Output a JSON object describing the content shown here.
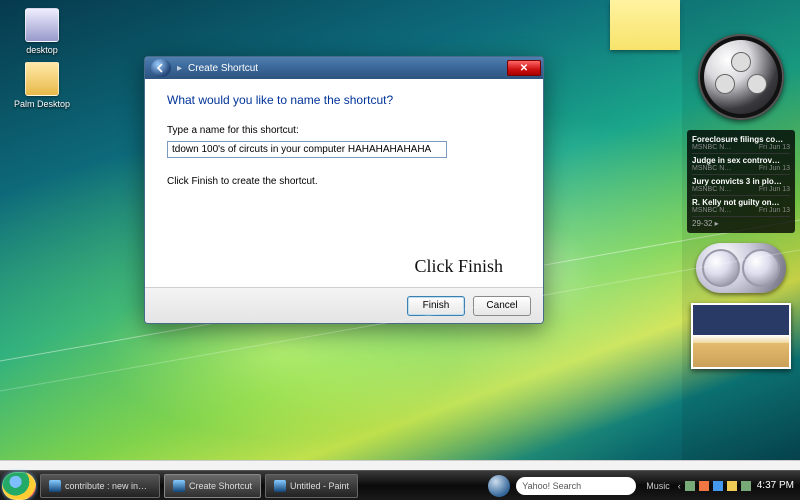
{
  "desktop_icons": [
    {
      "name": "desktop",
      "label": "desktop"
    },
    {
      "name": "palm-desktop",
      "label": "Palm Desktop"
    }
  ],
  "dialog": {
    "title": "Create Shortcut",
    "heading": "What would you like to name the shortcut?",
    "field_label": "Type a name for this shortcut:",
    "field_value": "tdown 100's of circuts in your computer HAHAHAHAHAHA",
    "hint": "Click Finish to create the shortcut.",
    "annotation": "Click   Finish",
    "finish": "Finish",
    "cancel": "Cancel"
  },
  "sidebar": {
    "feed": {
      "items": [
        {
          "headline": "Foreclosure filings co…",
          "source": "MSNBC N…",
          "date": "Fri Jun 13"
        },
        {
          "headline": "Judge in sex controv…",
          "source": "MSNBC N…",
          "date": "Fri Jun 13"
        },
        {
          "headline": "Jury convicts 3 in plo…",
          "source": "MSNBC N…",
          "date": "Fri Jun 13"
        },
        {
          "headline": "R. Kelly not guilty on…",
          "source": "MSNBC N…",
          "date": "Fri Jun 13"
        }
      ],
      "pager": "29-32 ▸"
    }
  },
  "taskbar": {
    "items": [
      {
        "label": "contribute : new ins…"
      },
      {
        "label": "Create Shortcut"
      },
      {
        "label": "Untitled - Paint"
      }
    ],
    "search_placeholder": "Yahoo! Search",
    "music_label": "Music",
    "time": "4:37 PM"
  }
}
